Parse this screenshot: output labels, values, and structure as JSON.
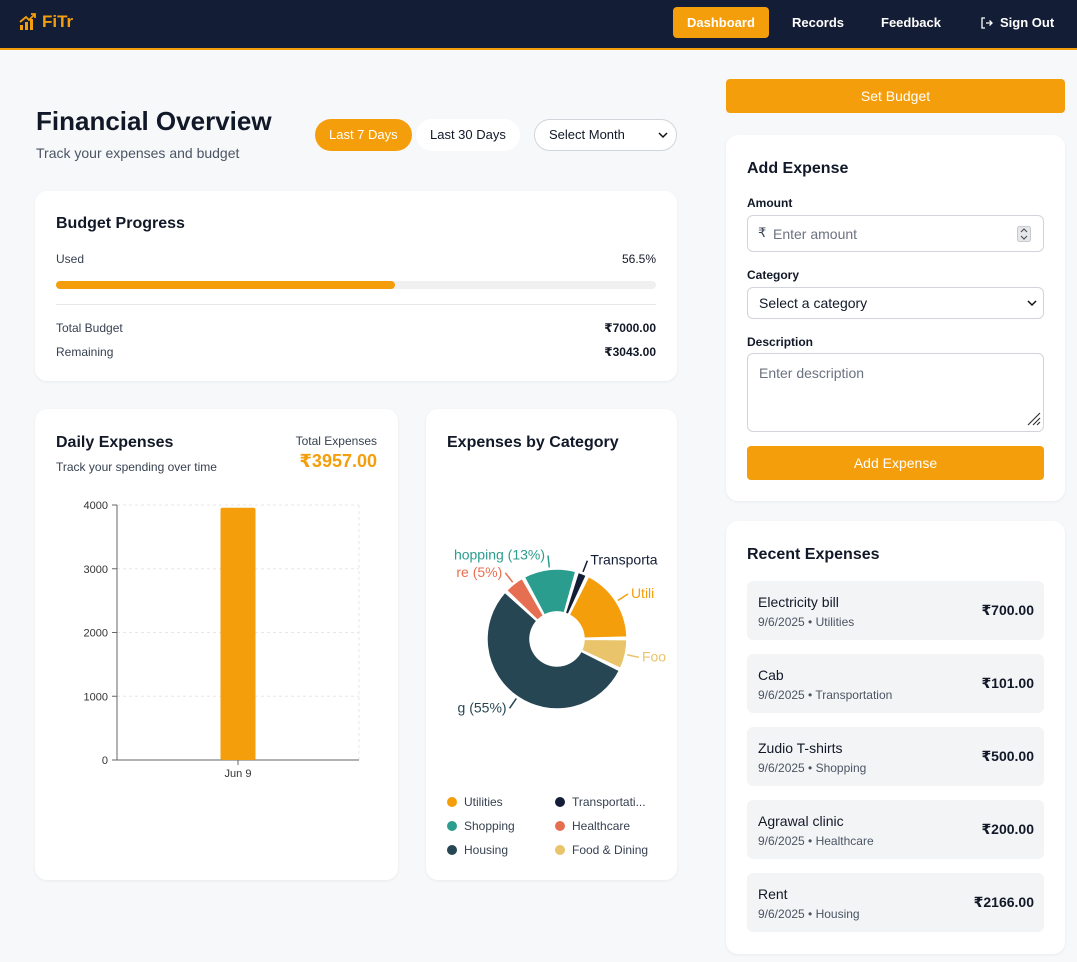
{
  "app": {
    "logo_text": "FiTr",
    "brand_color": "#f59e0b",
    "nav_bg": "#131e36"
  },
  "nav": {
    "dashboard": "Dashboard",
    "records": "Records",
    "feedback": "Feedback",
    "sign_out": "Sign Out"
  },
  "header": {
    "title": "Financial Overview",
    "subtitle": "Track your expenses and budget",
    "filter_7": "Last 7 Days",
    "filter_30": "Last 30 Days",
    "month_select": "Select Month"
  },
  "budget": {
    "title": "Budget Progress",
    "used_label": "Used",
    "used_pct_text": "56.5%",
    "used_fraction": 0.565,
    "total_label": "Total Budget",
    "total_value": "₹7000.00",
    "remaining_label": "Remaining",
    "remaining_value": "₹3043.00"
  },
  "daily": {
    "title": "Daily Expenses",
    "subtitle": "Track your spending over time",
    "total_label": "Total Expenses",
    "total_value": "₹3957.00"
  },
  "category_card": {
    "title": "Expenses by Category",
    "legend": [
      {
        "label": "Utilities",
        "color": "#f59e0b"
      },
      {
        "label": "Transportati...",
        "color": "#131e36"
      },
      {
        "label": "Shopping",
        "color": "#2a9d8f"
      },
      {
        "label": "Healthcare",
        "color": "#e76f51"
      },
      {
        "label": "Housing",
        "color": "#264653"
      },
      {
        "label": "Food & Dining",
        "color": "#e9c46a"
      }
    ]
  },
  "chart_data": [
    {
      "type": "bar",
      "categories": [
        "Jun 9"
      ],
      "values": [
        3957
      ],
      "ylim": [
        0,
        4000
      ],
      "yticks": [
        "0",
        "1000",
        "2000",
        "3000",
        "4000"
      ],
      "grid": true,
      "color": "#f59e0b"
    },
    {
      "type": "pie",
      "donut": true,
      "labels": [
        "Utilities",
        "Food & Dining",
        "Housing",
        "Healthcare",
        "Shopping",
        "Transportation"
      ],
      "values": [
        700,
        290,
        2166,
        200,
        500,
        101
      ],
      "colors": [
        "#f59e0b",
        "#e9c46a",
        "#264653",
        "#e76f51",
        "#2a9d8f",
        "#131e36"
      ],
      "data_labels": [
        "Utili",
        "Foo",
        "g (55%)",
        "re (5%)",
        "hopping (13%)",
        "Transporta"
      ]
    }
  ],
  "sidebar": {
    "set_budget": "Set Budget",
    "add_title": "Add Expense",
    "amount_label": "Amount",
    "currency_symbol": "₹",
    "amount_placeholder": "Enter amount",
    "category_label": "Category",
    "category_select": "Select a category",
    "description_label": "Description",
    "description_placeholder": "Enter description",
    "add_button": "Add Expense",
    "recent_title": "Recent Expenses",
    "recent": [
      {
        "title": "Electricity bill",
        "meta": "9/6/2025 • Utilities",
        "amount": "₹700.00"
      },
      {
        "title": "Cab",
        "meta": "9/6/2025 • Transportation",
        "amount": "₹101.00"
      },
      {
        "title": "Zudio T-shirts",
        "meta": "9/6/2025 • Shopping",
        "amount": "₹500.00"
      },
      {
        "title": "Agrawal clinic",
        "meta": "9/6/2025 • Healthcare",
        "amount": "₹200.00"
      },
      {
        "title": "Rent",
        "meta": "9/6/2025 • Housing",
        "amount": "₹2166.00"
      }
    ]
  }
}
